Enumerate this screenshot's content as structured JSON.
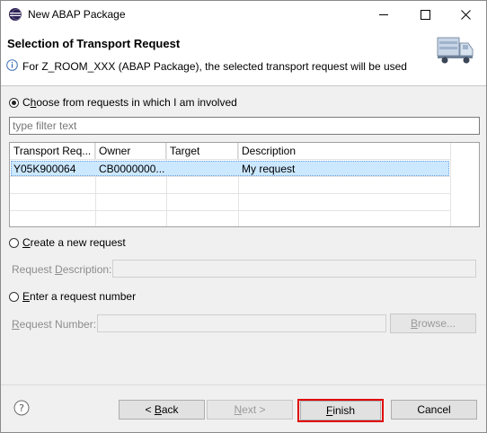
{
  "window": {
    "title": "New ABAP Package"
  },
  "header": {
    "title": "Selection of Transport Request",
    "message": "For Z_ROOM_XXX (ABAP Package), the selected transport request will be used"
  },
  "involved": {
    "label_pre": "C",
    "label_ul": "h",
    "label_post": "oose from requests in which I am involved",
    "checked": true,
    "filter_placeholder": "type filter text"
  },
  "table": {
    "columns": [
      "Transport Req...",
      "Owner",
      "Target",
      "Description"
    ],
    "rows": [
      {
        "request": "Y05K900064",
        "owner": "CB0000000...",
        "target": "",
        "description": "My request",
        "selected": true
      }
    ]
  },
  "create_new": {
    "label_ul": "C",
    "label_post": "reate a new request",
    "desc_label_pre": "Request ",
    "desc_label_ul": "D",
    "desc_label_post": "escription:"
  },
  "enter_number": {
    "label_ul": "E",
    "label_post": "nter a request number",
    "num_label_pre": "",
    "num_label_ul": "R",
    "num_label_post": "equest Number:",
    "browse_pre": "",
    "browse_ul": "B",
    "browse_post": "rowse..."
  },
  "footer": {
    "back_pre": "< ",
    "back_ul": "B",
    "back_post": "ack",
    "next_pre": "",
    "next_ul": "N",
    "next_post": "ext >",
    "finish_pre": "",
    "finish_ul": "F",
    "finish_post": "inish",
    "cancel": "Cancel"
  },
  "colors": {
    "highlight": "#e00000",
    "selection": "#cce8ff"
  }
}
